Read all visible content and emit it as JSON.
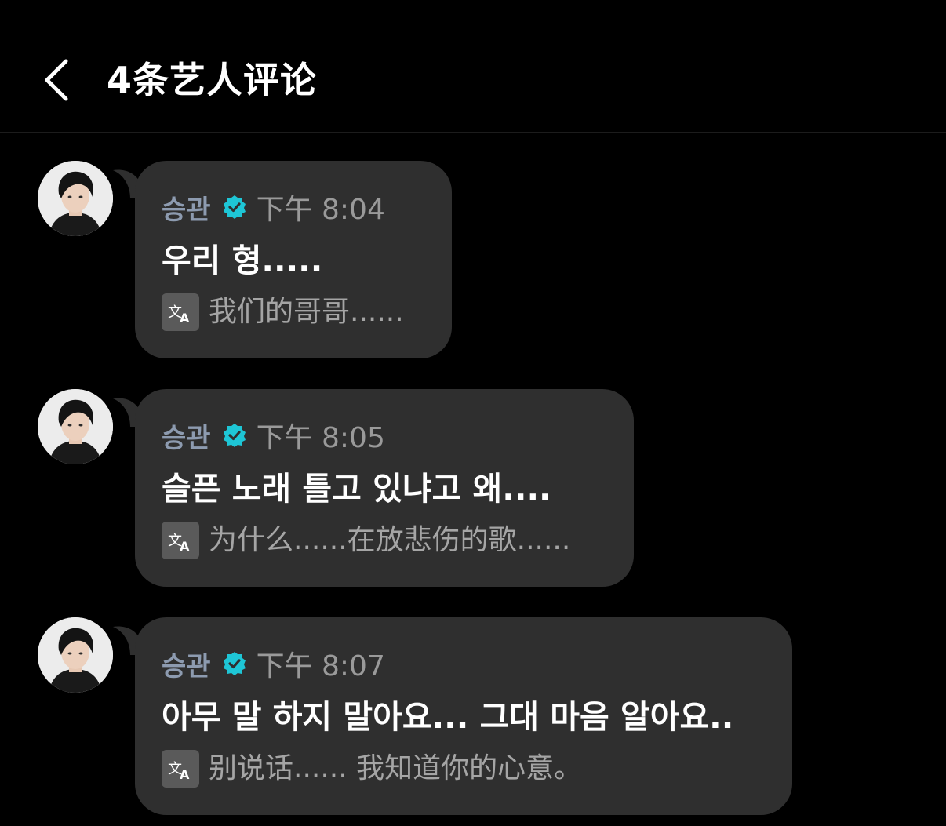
{
  "header": {
    "title": "4条艺人评论"
  },
  "comments": [
    {
      "author": "승관",
      "time": "下午 8:04",
      "original": "우리 형.....",
      "translation": "我们的哥哥......"
    },
    {
      "author": "승관",
      "time": "下午 8:05",
      "original": "슬픈 노래 틀고 있냐고 왜....",
      "translation": "为什么......在放悲伤的歌......"
    },
    {
      "author": "승관",
      "time": "下午 8:07",
      "original": "아무 말 하지 말아요... 그대 마음 알아요..",
      "translation": "别说话...... 我知道你的心意。"
    }
  ],
  "icons": {
    "back": "chevron-left-icon",
    "verified": "verified-badge-icon",
    "translate": "translate-icon",
    "avatar": "artist-avatar"
  },
  "colors": {
    "background": "#000000",
    "bubble": "#2f2f2f",
    "author": "#8d9bb0",
    "verified": "#1ec6d6",
    "time": "#9a9a9a",
    "translation": "#a5a5a5"
  }
}
